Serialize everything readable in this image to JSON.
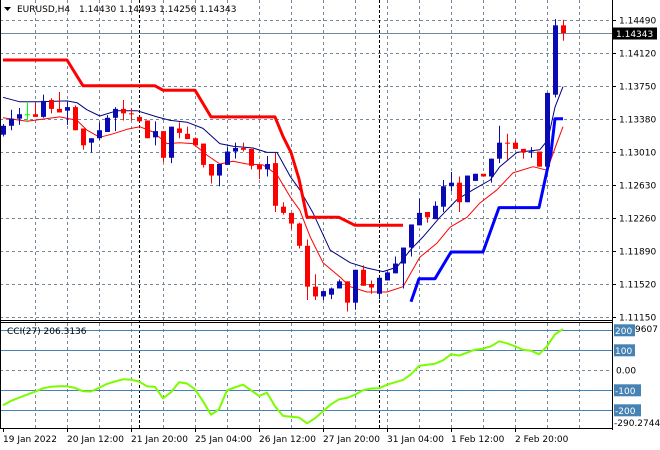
{
  "header": {
    "symbol": "EURUSD,H4",
    "ohlc": "1.14430 1.14493 1.14256 1.14343"
  },
  "chart_data": [
    {
      "type": "candlestick",
      "title": "EURUSD,H4",
      "ylim": [
        1.11115,
        1.14715
      ],
      "current_price": "1.14343",
      "price_ticks": [
        "1.14490",
        "1.14120",
        "1.13750",
        "1.13380",
        "1.13010",
        "1.12630",
        "1.12260",
        "1.11890",
        "1.11520",
        "1.11150"
      ],
      "time_labels": [
        {
          "index": 0,
          "label": "19 Jan 2022"
        },
        {
          "index": 8,
          "label": "20 Jan 12:00"
        },
        {
          "index": 16,
          "label": "21 Jan 20:00"
        },
        {
          "index": 24,
          "label": "25 Jan 04:00"
        },
        {
          "index": 32,
          "label": "26 Jan 12:00"
        },
        {
          "index": 40,
          "label": "27 Jan 20:00"
        },
        {
          "index": 48,
          "label": "31 Jan 04:00"
        },
        {
          "index": 56,
          "label": "1 Feb 12:00"
        },
        {
          "index": 64,
          "label": "2 Feb 20:00"
        }
      ],
      "period_separators": [
        17,
        47
      ],
      "ohlc": [
        [
          1.132,
          1.1332,
          1.1318,
          1.133
        ],
        [
          1.133,
          1.1348,
          1.1325,
          1.1338
        ],
        [
          1.1338,
          1.135,
          1.1331,
          1.1343
        ],
        [
          1.1343,
          1.1357,
          1.1334,
          1.1343
        ],
        [
          1.1343,
          1.1356,
          1.134,
          1.134
        ],
        [
          1.134,
          1.1365,
          1.1339,
          1.1358
        ],
        [
          1.1359,
          1.1361,
          1.1344,
          1.1349
        ],
        [
          1.1349,
          1.1368,
          1.1345,
          1.1345
        ],
        [
          1.1347,
          1.1357,
          1.1331,
          1.1351
        ],
        [
          1.1351,
          1.1353,
          1.1325,
          1.1325
        ],
        [
          1.1327,
          1.1327,
          1.1303,
          1.1308
        ],
        [
          1.1311,
          1.1316,
          1.13,
          1.1316
        ],
        [
          1.1316,
          1.1334,
          1.1314,
          1.1325
        ],
        [
          1.1323,
          1.1342,
          1.1323,
          1.1339
        ],
        [
          1.1339,
          1.1351,
          1.1324,
          1.1349
        ],
        [
          1.1349,
          1.1359,
          1.1336,
          1.1344
        ],
        [
          1.1344,
          1.135,
          1.1336,
          1.1343
        ],
        [
          1.134,
          1.134,
          1.1335,
          1.1335
        ],
        [
          1.1336,
          1.1336,
          1.1316,
          1.1316
        ],
        [
          1.1317,
          1.1335,
          1.1308,
          1.1324
        ],
        [
          1.1324,
          1.1324,
          1.1289,
          1.1294
        ],
        [
          1.1294,
          1.1329,
          1.1288,
          1.1329
        ],
        [
          1.1327,
          1.1334,
          1.1316,
          1.1322
        ],
        [
          1.1321,
          1.1329,
          1.1315,
          1.1315
        ],
        [
          1.1316,
          1.1317,
          1.1308,
          1.1308
        ],
        [
          1.131,
          1.131,
          1.1283,
          1.1286
        ],
        [
          1.1287,
          1.1287,
          1.1265,
          1.1274
        ],
        [
          1.1274,
          1.1287,
          1.1262,
          1.1287
        ],
        [
          1.1286,
          1.1306,
          1.1286,
          1.1301
        ],
        [
          1.1301,
          1.1311,
          1.1293,
          1.1305
        ],
        [
          1.1305,
          1.1311,
          1.1301,
          1.1303
        ],
        [
          1.1304,
          1.1304,
          1.1281,
          1.1285
        ],
        [
          1.1286,
          1.1286,
          1.127,
          1.1281
        ],
        [
          1.1281,
          1.1296,
          1.1273,
          1.1287
        ],
        [
          1.1288,
          1.13,
          1.1233,
          1.124
        ],
        [
          1.1239,
          1.1244,
          1.123,
          1.1232
        ],
        [
          1.1232,
          1.1232,
          1.1214,
          1.122
        ],
        [
          1.122,
          1.1221,
          1.1192,
          1.1195
        ],
        [
          1.1195,
          1.1202,
          1.1134,
          1.1149
        ],
        [
          1.1149,
          1.1163,
          1.1134,
          1.1138
        ],
        [
          1.1138,
          1.1144,
          1.1134,
          1.1144
        ],
        [
          1.114,
          1.1148,
          1.1135,
          1.1147
        ],
        [
          1.1147,
          1.1157,
          1.1147,
          1.1155
        ],
        [
          1.1155,
          1.1155,
          1.1121,
          1.1131
        ],
        [
          1.1131,
          1.1168,
          1.1123,
          1.1168
        ],
        [
          1.1168,
          1.1173,
          1.115,
          1.115
        ],
        [
          1.1152,
          1.1156,
          1.1141,
          1.1148
        ],
        [
          1.1141,
          1.1159,
          1.1135,
          1.1159
        ],
        [
          1.1156,
          1.1166,
          1.1156,
          1.1165
        ],
        [
          1.1164,
          1.1183,
          1.1164,
          1.1175
        ],
        [
          1.1175,
          1.1193,
          1.1147,
          1.1193
        ],
        [
          1.1193,
          1.1219,
          1.1183,
          1.1219
        ],
        [
          1.1218,
          1.1248,
          1.1218,
          1.1232
        ],
        [
          1.1233,
          1.1233,
          1.1221,
          1.1227
        ],
        [
          1.1225,
          1.1245,
          1.1225,
          1.124
        ],
        [
          1.1239,
          1.1269,
          1.1233,
          1.1262
        ],
        [
          1.1262,
          1.1278,
          1.1256,
          1.1266
        ],
        [
          1.1266,
          1.1273,
          1.1233,
          1.1244
        ],
        [
          1.1244,
          1.1274,
          1.1244,
          1.1274
        ],
        [
          1.1268,
          1.1276,
          1.1268,
          1.1276
        ],
        [
          1.1276,
          1.1276,
          1.1273,
          1.1273
        ],
        [
          1.1273,
          1.1293,
          1.1266,
          1.1293
        ],
        [
          1.1293,
          1.133,
          1.1288,
          1.1311
        ],
        [
          1.1311,
          1.1321,
          1.1292,
          1.131
        ],
        [
          1.1311,
          1.1314,
          1.1304,
          1.1304
        ],
        [
          1.1304,
          1.1304,
          1.1293,
          1.13
        ],
        [
          1.13,
          1.1306,
          1.1294,
          1.1301
        ],
        [
          1.1301,
          1.1301,
          1.1284,
          1.1284
        ],
        [
          1.1284,
          1.1367,
          1.1284,
          1.1367
        ],
        [
          1.1365,
          1.145,
          1.1362,
          1.1443
        ],
        [
          1.1443,
          1.14493,
          1.14256,
          1.14343
        ]
      ],
      "lines": [
        {
          "name": "upper-ma",
          "color": "#000080",
          "width": 1,
          "points": [
            [
              0,
              1.1362
            ],
            [
              2.1,
              1.1357
            ],
            [
              4.6,
              1.1357
            ],
            [
              8,
              1.1358
            ],
            [
              9.25,
              1.1356
            ],
            [
              10.5,
              1.1348
            ],
            [
              12.1,
              1.1341
            ],
            [
              14.25,
              1.1347
            ],
            [
              16.75,
              1.1347
            ],
            [
              19.25,
              1.134
            ],
            [
              20.9,
              1.1336
            ],
            [
              23,
              1.1334
            ],
            [
              25,
              1.1327
            ],
            [
              27.1,
              1.131
            ],
            [
              28.75,
              1.1307
            ],
            [
              31.25,
              1.1305
            ],
            [
              33,
              1.13
            ],
            [
              34.25,
              1.13
            ],
            [
              35.9,
              1.1273
            ],
            [
              37.1,
              1.1258
            ],
            [
              38.75,
              1.1232
            ],
            [
              40.9,
              1.119
            ],
            [
              43.4,
              1.1176
            ],
            [
              45.5,
              1.117
            ],
            [
              47.5,
              1.1166
            ],
            [
              49.25,
              1.1171
            ],
            [
              50.9,
              1.119
            ],
            [
              52.5,
              1.1205
            ],
            [
              54.6,
              1.1227
            ],
            [
              56.75,
              1.1247
            ],
            [
              58.75,
              1.1258
            ],
            [
              60.9,
              1.1269
            ],
            [
              62.1,
              1.1284
            ],
            [
              64.25,
              1.13
            ],
            [
              67.1,
              1.1303
            ],
            [
              68.1,
              1.1314
            ],
            [
              69,
              1.1351
            ],
            [
              70,
              1.1374
            ]
          ]
        },
        {
          "name": "lower-ma",
          "color": "#ff0000",
          "width": 1,
          "points": [
            [
              0,
              1.1339
            ],
            [
              3,
              1.1335
            ],
            [
              7.1,
              1.134
            ],
            [
              9.25,
              1.1336
            ],
            [
              10.5,
              1.1325
            ],
            [
              12.1,
              1.1317
            ],
            [
              13.75,
              1.1321
            ],
            [
              15.5,
              1.1326
            ],
            [
              17.1,
              1.1329
            ],
            [
              18.75,
              1.1323
            ],
            [
              20.5,
              1.131
            ],
            [
              22.1,
              1.1311
            ],
            [
              23.75,
              1.131
            ],
            [
              25.5,
              1.1297
            ],
            [
              27.1,
              1.1287
            ],
            [
              28.75,
              1.129
            ],
            [
              30.5,
              1.1287
            ],
            [
              32.5,
              1.1286
            ],
            [
              34.25,
              1.1275
            ],
            [
              35.9,
              1.125
            ],
            [
              37.1,
              1.1235
            ],
            [
              38.4,
              1.1205
            ],
            [
              40,
              1.1176
            ],
            [
              42.1,
              1.116
            ],
            [
              43.4,
              1.1149
            ],
            [
              45.5,
              1.1143
            ],
            [
              48,
              1.1143
            ],
            [
              50,
              1.1149
            ],
            [
              52.1,
              1.1182
            ],
            [
              54.25,
              1.1198
            ],
            [
              55.9,
              1.1216
            ],
            [
              58,
              1.1227
            ],
            [
              59.6,
              1.1243
            ],
            [
              61.75,
              1.1258
            ],
            [
              63.75,
              1.1277
            ],
            [
              66.25,
              1.1284
            ],
            [
              68,
              1.128
            ],
            [
              69.25,
              1.1311
            ],
            [
              70,
              1.1329
            ]
          ]
        },
        {
          "name": "resistance-stop",
          "color": "#ff0000",
          "width": 3,
          "points": [
            [
              0,
              1.1404
            ],
            [
              8,
              1.1404
            ],
            [
              10,
              1.1375
            ],
            [
              19,
              1.1375
            ],
            [
              20,
              1.137
            ],
            [
              24,
              1.137
            ],
            [
              26,
              1.134
            ],
            [
              34,
              1.134
            ],
            [
              35,
              1.1318
            ],
            [
              36,
              1.13
            ],
            [
              37,
              1.127
            ],
            [
              38,
              1.1227
            ],
            [
              42,
              1.1227
            ],
            [
              44,
              1.1218
            ],
            [
              50,
              1.1218
            ]
          ]
        },
        {
          "name": "support-stop",
          "color": "#0000ff",
          "width": 3,
          "points": [
            [
              51,
              1.1132
            ],
            [
              52,
              1.1158
            ],
            [
              54,
              1.1158
            ],
            [
              56,
              1.1188
            ],
            [
              60,
              1.1188
            ],
            [
              62,
              1.1238
            ],
            [
              67,
              1.1238
            ],
            [
              68.5,
              1.13
            ],
            [
              69,
              1.1338
            ],
            [
              70,
              1.1338
            ]
          ]
        }
      ],
      "colors": {
        "bull": "#0a0ab4",
        "bear": "#ff0000",
        "doji": "#00ff00",
        "grid": "#778899",
        "current_line": "#778899"
      }
    },
    {
      "type": "line",
      "title": "CCI(27) 206.3136",
      "ylim": [
        -290.2744,
        228.9607
      ],
      "max_label": "228.9607",
      "min_label": "-290.2744",
      "zero_label": "0.00",
      "levels": [
        {
          "value": 200,
          "label": "200"
        },
        {
          "value": 100,
          "label": "100"
        },
        {
          "value": -100,
          "label": "-100"
        },
        {
          "value": -200,
          "label": "-200"
        }
      ],
      "color": "#7cfc00",
      "level_color": "#4682b4",
      "values": [
        -175,
        -153,
        -137,
        -122,
        -107,
        -90,
        -82,
        -80,
        -80,
        -88,
        -105,
        -106,
        -88,
        -68,
        -56,
        -45,
        -47,
        -56,
        -80,
        -83,
        -140,
        -110,
        -60,
        -66,
        -95,
        -155,
        -222,
        -195,
        -100,
        -85,
        -72,
        -100,
        -128,
        -112,
        -180,
        -228,
        -232,
        -236,
        -265,
        -240,
        -205,
        -170,
        -145,
        -138,
        -122,
        -100,
        -91,
        -90,
        -72,
        -60,
        -48,
        -20,
        22,
        28,
        33,
        50,
        80,
        74,
        88,
        103,
        108,
        120,
        145,
        135,
        120,
        103,
        98,
        80,
        120,
        180,
        206.3136
      ]
    }
  ]
}
